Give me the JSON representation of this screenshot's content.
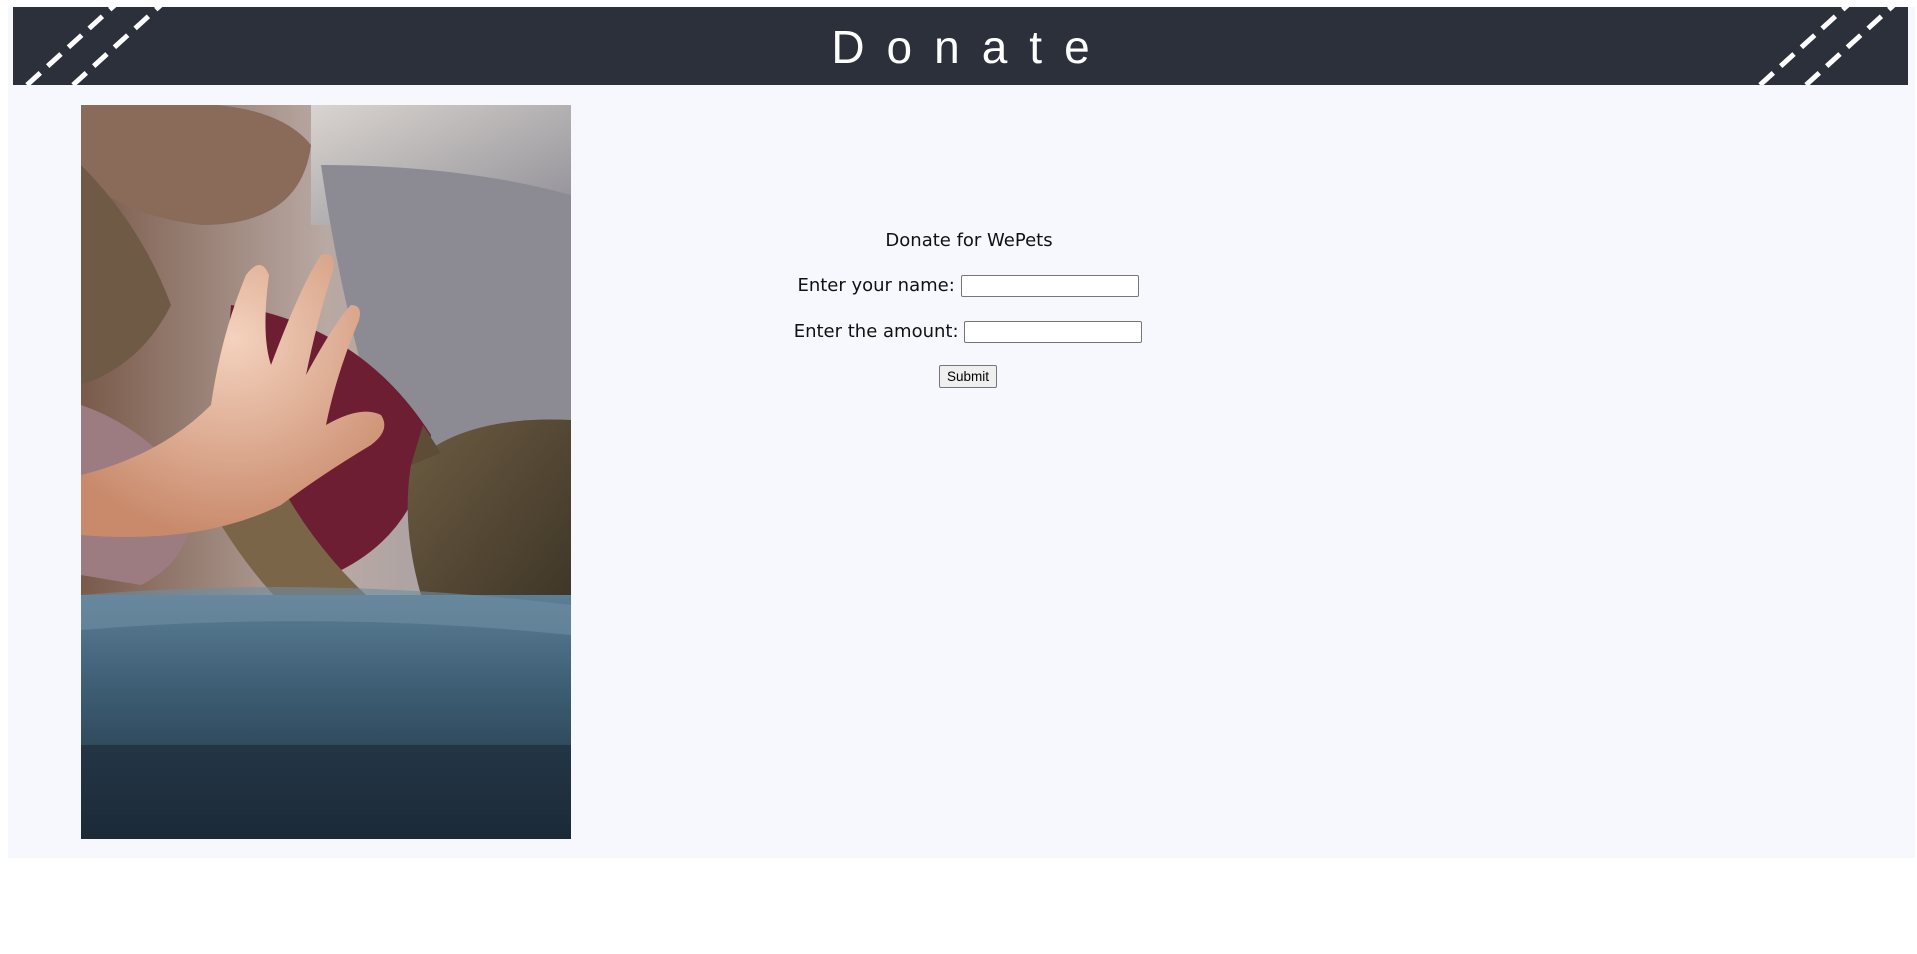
{
  "header": {
    "title": "Donate"
  },
  "photo": {
    "description_icon": "photo-hand-high-five-cat"
  },
  "form": {
    "title": "Donate for WePets",
    "name_label": "Enter your name:",
    "name_value": "",
    "amount_label": "Enter the amount:",
    "amount_value": "",
    "submit_label": "Submit"
  },
  "colors": {
    "header_bg": "#2b303b",
    "page_bg": "#f7f8fd",
    "header_text": "#ffffff"
  }
}
